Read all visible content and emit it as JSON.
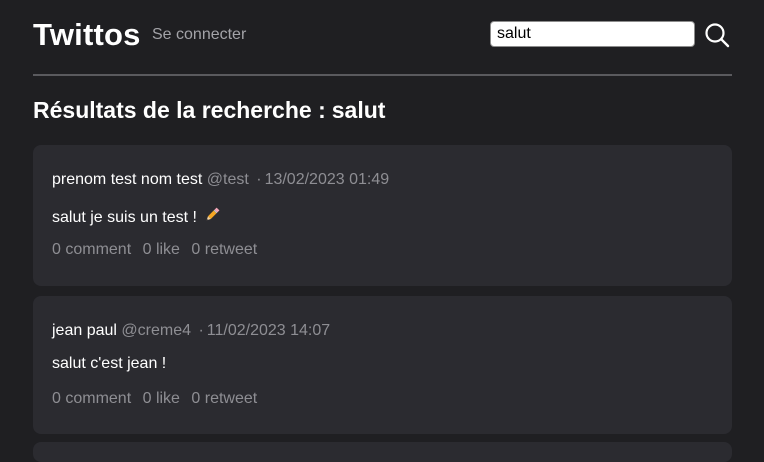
{
  "header": {
    "brand": "Twittos",
    "login_label": "Se connecter",
    "search_value": "salut"
  },
  "results": {
    "title_prefix": "Résultats de la recherche :",
    "query": "salut"
  },
  "posts": [
    {
      "author": "prenom test nom test",
      "handle": "@test",
      "separator": "·",
      "date": "13/02/2023 01:49",
      "text": "salut je suis un test !",
      "emoji": "pencil-icon",
      "comments": "0 comment",
      "likes": "0 like",
      "retweets": "0 retweet"
    },
    {
      "author": "jean paul",
      "handle": "@creme4",
      "separator": "·",
      "date": "11/02/2023 14:07",
      "text": "salut c'est jean !",
      "comments": "0 comment",
      "likes": "0 like",
      "retweets": "0 retweet"
    }
  ],
  "colors": {
    "background": "#1f1f22",
    "card": "#2b2b30",
    "muted_text": "#8e8e93",
    "divider": "#5a5a5e"
  }
}
